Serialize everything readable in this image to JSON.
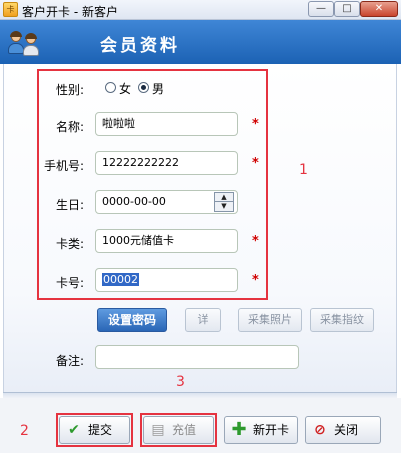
{
  "window": {
    "title": "客户开卡 - 新客户",
    "app_icon_text": "卡",
    "min_glyph": "—",
    "max_glyph": "□",
    "close_glyph": "✕"
  },
  "header": {
    "title": "会员资料"
  },
  "form": {
    "gender_label": "性别:",
    "gender_options": [
      "女",
      "男"
    ],
    "gender_selected": "男",
    "name_label": "名称:",
    "name_value": "啦啦啦",
    "phone_label": "手机号:",
    "phone_value": "12222222222",
    "birthday_label": "生日:",
    "birthday_value": "0000-00-00",
    "card_type_label": "卡类:",
    "card_type_value": "1000元储值卡",
    "card_no_label": "卡号:",
    "card_no_value": "00002",
    "required_mark": "*",
    "remark_label": "备注:",
    "remark_value": ""
  },
  "actions": {
    "set_password": "设置密码",
    "details": "详",
    "capture_photo": "采集照片",
    "capture_fingerprint": "采集指纹"
  },
  "footer": {
    "submit": "提交",
    "recharge": "充值",
    "new_card": "新开卡",
    "close": "关闭"
  },
  "annotations": {
    "box1": "1",
    "box2": "2",
    "box3": "3"
  },
  "colors": {
    "accent": "#2a66b6",
    "annotation_red": "#e53340",
    "required_red": "#d00000"
  }
}
